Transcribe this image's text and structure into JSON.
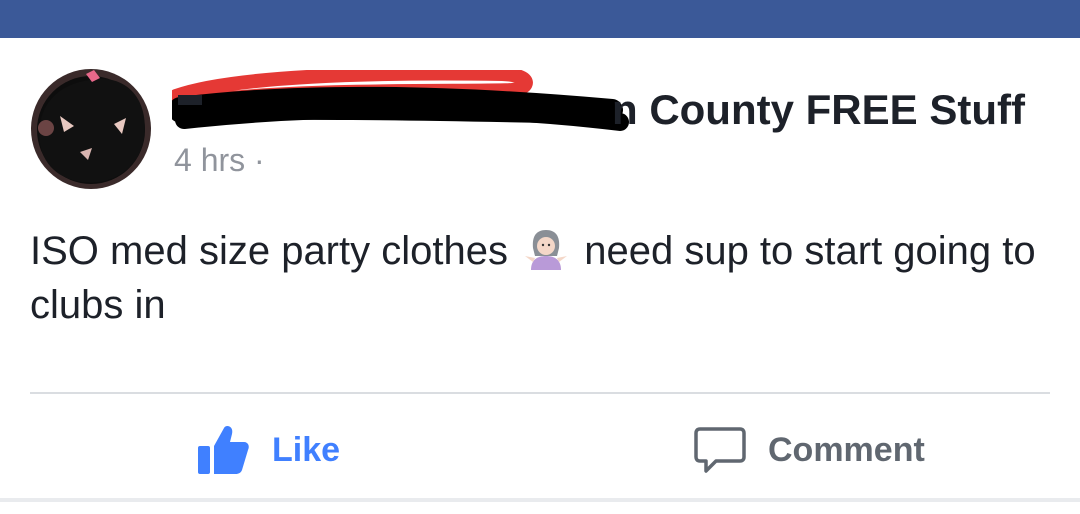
{
  "colors": {
    "top_bar": "#3b5998",
    "like_blue": "#4080ff",
    "text_primary": "#1d2129",
    "text_secondary": "#90949c",
    "divider": "#dadde1"
  },
  "post": {
    "group_name_visible": "n County FREE Stuff",
    "timestamp": "4 hrs ·",
    "body_part1": "ISO med size party clothes",
    "body_emoji": "person-shrugging-emoji",
    "body_part2": "need sup to start going to clubs in"
  },
  "actions": {
    "like_label": "Like",
    "like_icon": "thumbs-up-icon",
    "comment_label": "Comment",
    "comment_icon": "speech-bubble-icon"
  }
}
